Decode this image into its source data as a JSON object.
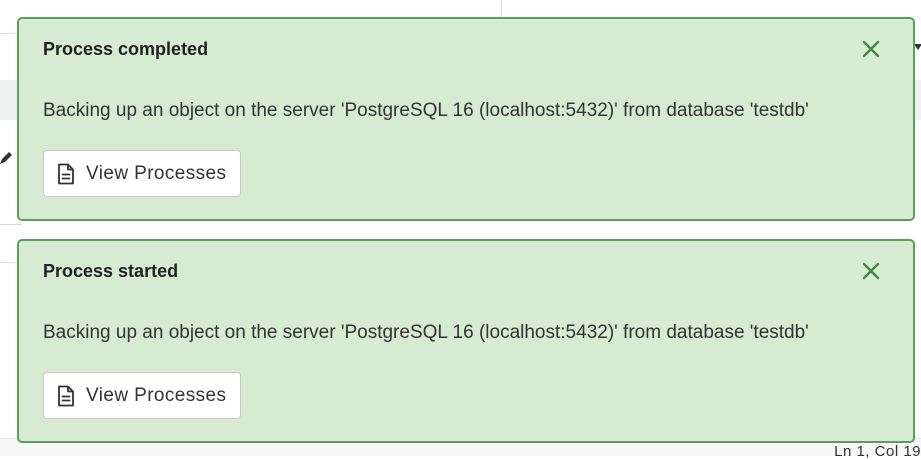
{
  "background": {
    "cursor_position": "Ln 1, Col 19"
  },
  "toasts": [
    {
      "title": "Process completed",
      "message": "Backing up an object on the server 'PostgreSQL 16 (localhost:5432)' from database 'testdb'",
      "button_label": "View Processes",
      "button_icon": "document-icon",
      "close_icon": "close-icon"
    },
    {
      "title": "Process started",
      "message": "Backing up an object on the server 'PostgreSQL 16 (localhost:5432)' from database 'testdb'",
      "button_label": "View Processes",
      "button_icon": "document-icon",
      "close_icon": "close-icon"
    }
  ],
  "colors": {
    "toast_background": "#d6ebd2",
    "toast_border": "#5ba05a",
    "close_icon": "#3b8a3e"
  }
}
